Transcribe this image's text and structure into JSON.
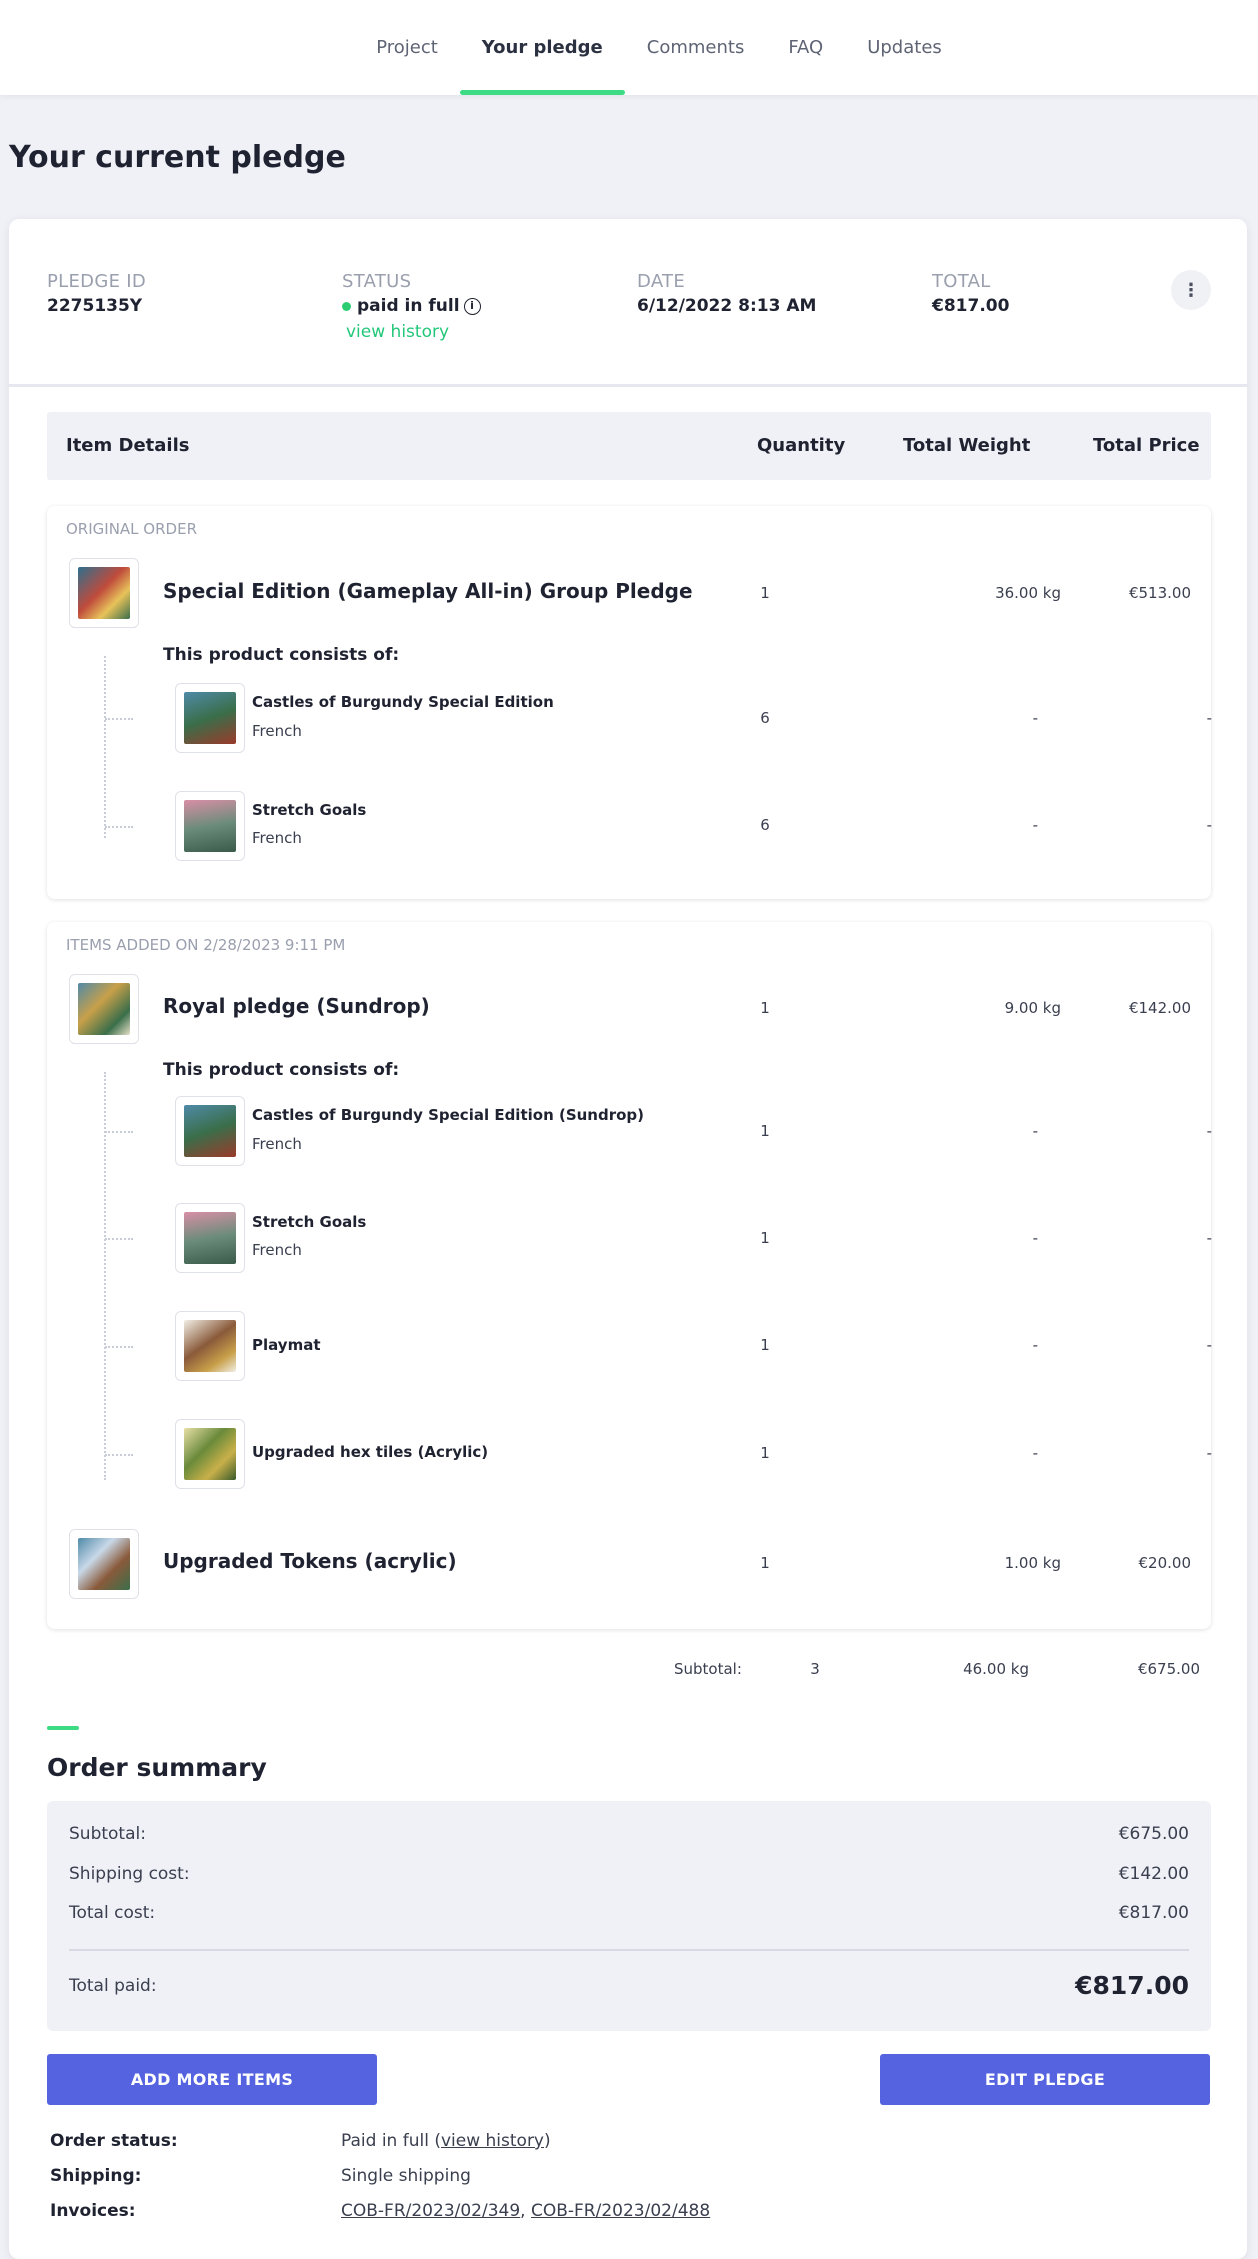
{
  "nav": {
    "tabs": [
      {
        "label": "Project"
      },
      {
        "label": "Your pledge"
      },
      {
        "label": "Comments"
      },
      {
        "label": "FAQ"
      },
      {
        "label": "Updates"
      }
    ],
    "active_index": 1
  },
  "page_title": "Your current pledge",
  "pledge": {
    "id_label": "PLEDGE ID",
    "id_value": "2275135Y",
    "status_label": "STATUS",
    "status_value": "paid in full",
    "status_info_icon": "info-icon",
    "view_history": "view history",
    "date_label": "DATE",
    "date_value": "6/12/2022 8:13 AM",
    "total_label": "TOTAL",
    "total_value": "€817.00",
    "more_icon": "⋮"
  },
  "table_header": {
    "item_details": "Item Details",
    "quantity": "Quantity",
    "total_weight": "Total Weight",
    "total_price": "Total Price"
  },
  "consists_label": "This product consists of:",
  "sections": [
    {
      "label": "ORIGINAL ORDER",
      "products": [
        {
          "name": "Special Edition (Gameplay All-in) Group Pledge",
          "qty": "1",
          "weight": "36.00 kg",
          "price": "€513.00",
          "items": [
            {
              "name": "Castles of Burgundy Special Edition",
              "lang": "French",
              "qty": "6",
              "weight": "-",
              "price": "-"
            },
            {
              "name": "Stretch Goals",
              "lang": "French",
              "qty": "6",
              "weight": "-",
              "price": "-"
            }
          ]
        }
      ]
    },
    {
      "label": "ITEMS ADDED ON 2/28/2023 9:11 PM",
      "products": [
        {
          "name": "Royal pledge (Sundrop)",
          "qty": "1",
          "weight": "9.00 kg",
          "price": "€142.00",
          "items": [
            {
              "name": "Castles of Burgundy Special Edition (Sundrop)",
              "lang": "French",
              "qty": "1",
              "weight": "-",
              "price": "-"
            },
            {
              "name": "Stretch Goals",
              "lang": "French",
              "qty": "1",
              "weight": "-",
              "price": "-"
            },
            {
              "name": "Playmat",
              "lang": "",
              "qty": "1",
              "weight": "-",
              "price": "-"
            },
            {
              "name": "Upgraded hex tiles (Acrylic)",
              "lang": "",
              "qty": "1",
              "weight": "-",
              "price": "-"
            }
          ]
        },
        {
          "name": "Upgraded Tokens (acrylic)",
          "qty": "1",
          "weight": "1.00 kg",
          "price": "€20.00",
          "items": []
        }
      ]
    }
  ],
  "subtotal_row": {
    "label": "Subtotal:",
    "qty": "3",
    "weight": "46.00 kg",
    "price": "€675.00"
  },
  "order_summary": {
    "title": "Order summary",
    "subtotal_label": "Subtotal:",
    "subtotal_value": "€675.00",
    "shipping_label": "Shipping cost:",
    "shipping_value": "€142.00",
    "total_cost_label": "Total cost:",
    "total_cost_value": "€817.00",
    "total_paid_label": "Total paid:",
    "total_paid_value": "€817.00"
  },
  "buttons": {
    "add_more": "ADD MORE ITEMS",
    "edit": "EDIT PLEDGE"
  },
  "info": {
    "order_status_label": "Order status:",
    "order_status_prefix": "Paid in full (",
    "order_status_link": "view history",
    "order_status_suffix": ")",
    "shipping_label": "Shipping:",
    "shipping_value": "Single shipping",
    "invoices_label": "Invoices:",
    "invoice_1": "COB-FR/2023/02/349",
    "invoice_sep": ", ",
    "invoice_2": "COB-FR/2023/02/488"
  },
  "colors": {
    "accent_green": "#3ddc84",
    "button_blue": "#5563e0",
    "page_bg": "#f0f1f7"
  }
}
